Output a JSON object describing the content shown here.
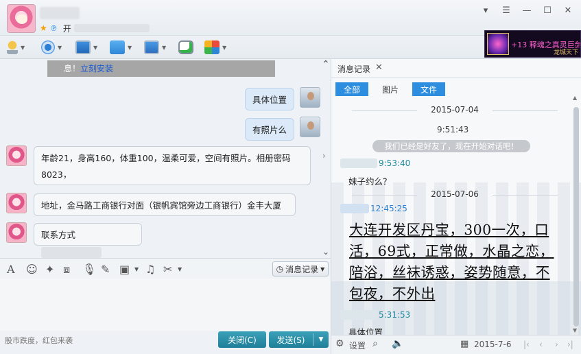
{
  "window": {
    "signature_visible": "开",
    "controls": {
      "dropdown": "▾",
      "menu": "☰",
      "minimize": "—",
      "maximize": "☐",
      "close": "✕"
    }
  },
  "ad": {
    "title": "+13 释魂之真灵巨剑",
    "sub": "龙城天下"
  },
  "chat": {
    "notice_text": "息！",
    "notice_link": "立刻安装",
    "messages": [
      {
        "from": "me",
        "text": "具体位置"
      },
      {
        "from": "me",
        "text": "有照片么"
      },
      {
        "from": "other",
        "text": "年龄21，身高160，体重100，温柔可爱，空间有照片。相册密码8023，"
      },
      {
        "from": "other",
        "text": "地址，金马路工商银行对面（银帆宾馆旁边工商银行）金丰大厦"
      },
      {
        "from": "other",
        "text": "联系方式"
      }
    ]
  },
  "inputbar": {
    "history_label": "消息记录"
  },
  "bottom": {
    "status": "股市跌度，红包来袭",
    "close_label": "关闭(C)",
    "send_label": "发送(S)"
  },
  "history": {
    "tab_label": "消息记录",
    "filters": [
      "全部",
      "图片",
      "文件"
    ],
    "date1": "2015-07-04",
    "time1": "9:51:43",
    "system_msg": "我们已经是好友了，现在开始对话吧！",
    "time2": "9:53:40",
    "text2": "妹子约么？",
    "date2": "2015-07-06",
    "time3": "12:45:25",
    "big_text": "大连开发区丹宝，300一次，口活，69式，正常做，水晶之恋，陪浴，丝袜诱惑，姿势随意，不包夜，不外出",
    "time4": "5:31:53",
    "text4": "具体位置",
    "footer_settings": "设置",
    "footer_date": "2015-7-6"
  }
}
